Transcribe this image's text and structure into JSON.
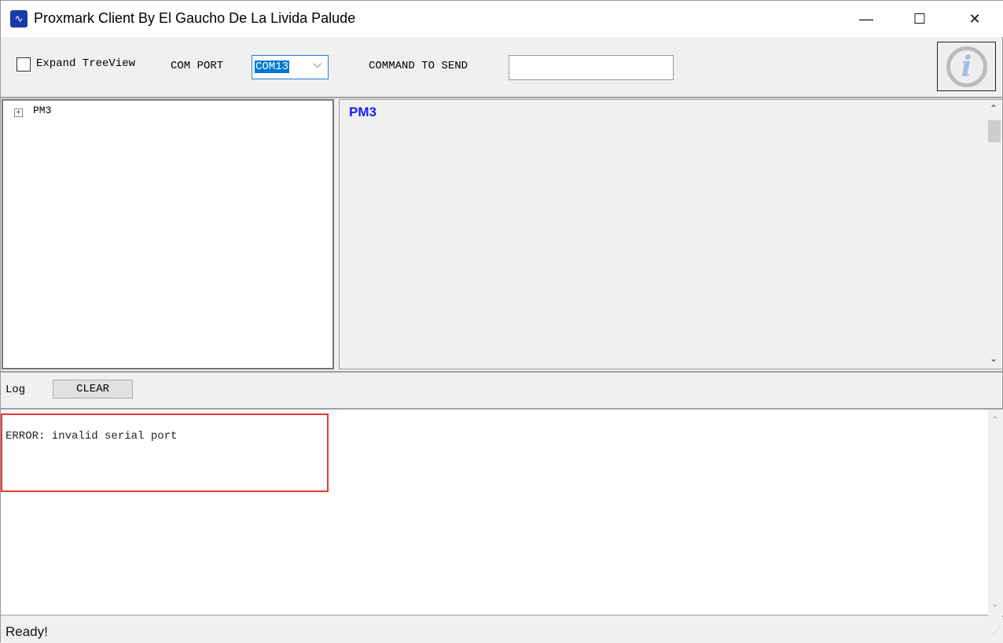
{
  "window": {
    "title": "Proxmark Client By El Gaucho De La Livida Palude",
    "minimize": "—",
    "maximize": "☐",
    "close": "✕"
  },
  "toolbar": {
    "expand_label": "Expand TreeView",
    "expand_checked": false,
    "com_port_label": "COM PORT",
    "com_port_value": "COM13",
    "command_label": "COMMAND TO SEND",
    "command_value": ""
  },
  "tree": {
    "root": "PM3"
  },
  "output": {
    "heading": "PM3"
  },
  "log": {
    "label": "Log",
    "clear_label": "CLEAR",
    "lines": [
      "ERROR: invalid serial port"
    ]
  },
  "status": {
    "text": "Ready!"
  },
  "colors": {
    "heading": "#1a1aff",
    "highlight": "#e53935",
    "selection": "#0078d7"
  }
}
